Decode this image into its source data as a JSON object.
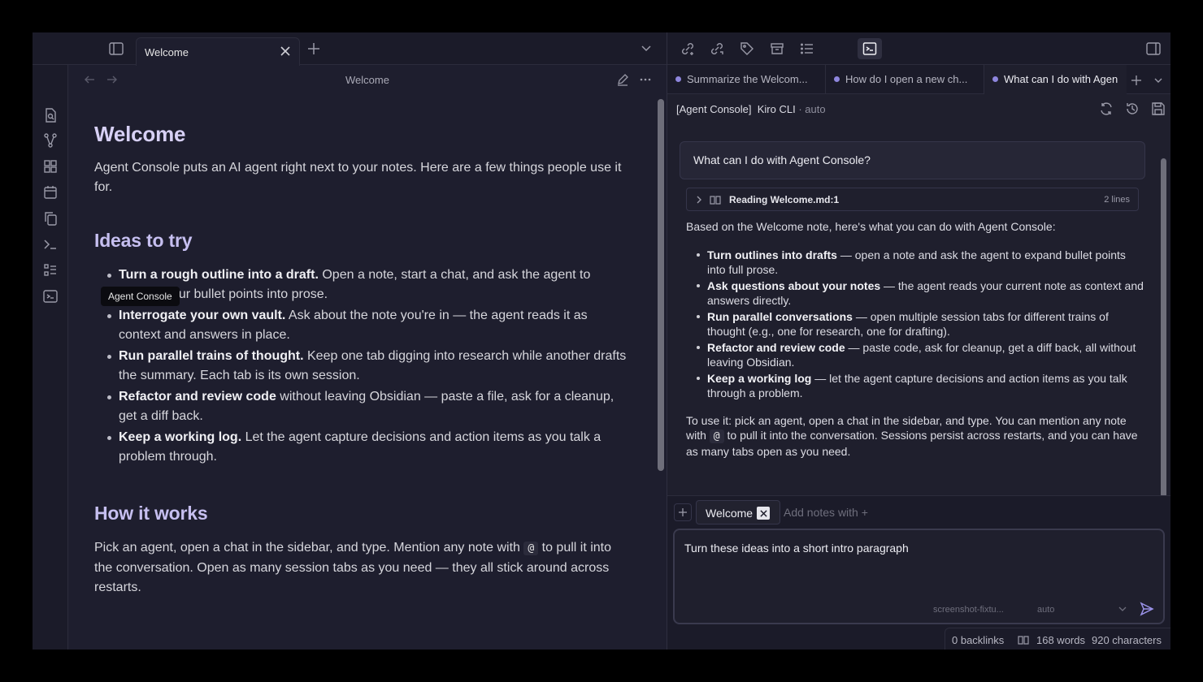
{
  "left_pane": {
    "tab_title": "Welcome",
    "editor_title": "Welcome",
    "tooltip": "Agent Console",
    "ribbon_icons": [
      "search-file-icon",
      "graph-icon",
      "grid-icon",
      "calendar-icon",
      "copy-icon",
      "terminal-icon",
      "checklist-icon",
      "agent-console-icon"
    ]
  },
  "note": {
    "h1": "Welcome",
    "intro": "Agent Console puts an AI agent right next to your notes. Here are a few things people use it for.",
    "ideas_heading": "Ideas to try",
    "ideas": [
      {
        "bold": "Turn a rough outline into a draft.",
        "text": " Open a note, start a chat, and ask the agent to expand your bullet points into prose."
      },
      {
        "bold": "Interrogate your own vault.",
        "text": " Ask about the note you're in — the agent reads it as context and answers in place."
      },
      {
        "bold": "Run parallel trains of thought.",
        "text": " Keep one tab digging into research while another drafts the summary. Each tab is its own session."
      },
      {
        "bold": "Refactor and review code",
        "text": " without leaving Obsidian — paste a file, ask for a cleanup, get a diff back."
      },
      {
        "bold": "Keep a working log.",
        "text": " Let the agent capture decisions and action items as you talk a problem through."
      }
    ],
    "how_heading": "How it works",
    "how_before": "Pick an agent, open a chat in the sidebar, and type. Mention any note with ",
    "how_code": "@",
    "how_after": " to pull it into the conversation. Open as many session tabs as you need — they all stick around across restarts."
  },
  "right_pane": {
    "session_tabs": [
      {
        "label": "Summarize the Welcom..."
      },
      {
        "label": "How do I open a new ch..."
      },
      {
        "label": "What can I do with Agen"
      }
    ],
    "agent_header": {
      "prefix": "[Agent Console]",
      "agent": "Kiro CLI",
      "sep": " · ",
      "mode": "auto"
    },
    "user_message": "What can I do with Agent Console?",
    "tool_call": {
      "label": "Reading Welcome.md:1",
      "lines": "2 lines"
    },
    "reply": {
      "intro": "Based on the Welcome note, here's what you can do with Agent Console:",
      "items": [
        {
          "bold": "Turn outlines into drafts",
          "text": " — open a note and ask the agent to expand bullet points into full prose."
        },
        {
          "bold": "Ask questions about your notes",
          "text": " — the agent reads your current note as context and answers directly."
        },
        {
          "bold": "Run parallel conversations",
          "text": " — open multiple session tabs for different trains of thought (e.g., one for research, one for drafting)."
        },
        {
          "bold": "Refactor and review code",
          "text": " — paste code, ask for cleanup, get a diff back, all without leaving Obsidian."
        },
        {
          "bold": "Keep a working log",
          "text": " — let the agent capture decisions and action items as you talk through a problem."
        }
      ],
      "outro_before": "To use it: pick an agent, open a chat in the sidebar, and type. You can mention any note with ",
      "outro_code": "@",
      "outro_after": " to pull it into the conversation. Sessions persist across restarts, and you can have as many tabs open as you need."
    },
    "context_chip": "Welcome",
    "context_hint": "Add notes with +",
    "composer_text": "Turn these ideas into a short intro paragraph",
    "model_select": "screenshot-fixtu...",
    "mode_select": "auto"
  },
  "status_bar": {
    "backlinks": "0 backlinks",
    "words": "168 words",
    "characters": "920 characters"
  }
}
